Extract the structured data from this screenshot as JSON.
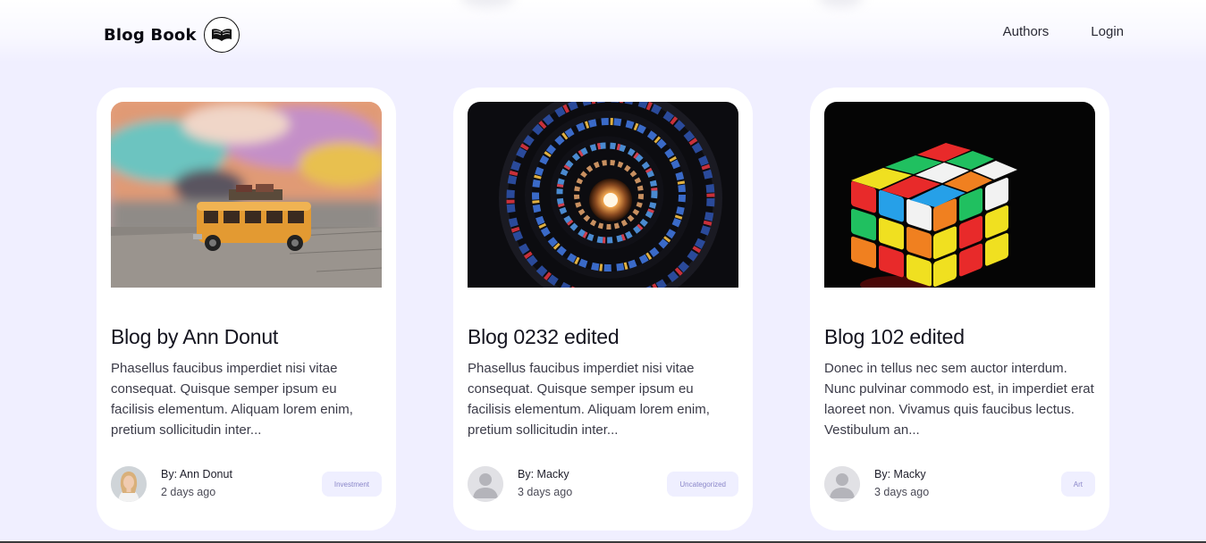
{
  "header": {
    "brand": "Blog Book",
    "logo_icon": "open-book-icon",
    "nav": [
      {
        "label": "Authors"
      },
      {
        "label": "Login"
      }
    ]
  },
  "posts": [
    {
      "title": "Blog by Ann Donut",
      "excerpt": "Phasellus faucibus imperdiet nisi vitae consequat. Quisque semper ipsum eu facilisis elementum. Aliquam lorem enim, pretium sollicitudin inter...",
      "author": "By: Ann Donut",
      "time": "2 days ago",
      "tag": "Investment",
      "image": "toy-bus-photo",
      "avatar": "author-photo"
    },
    {
      "title": "Blog 0232 edited",
      "excerpt": "Phasellus faucibus imperdiet nisi vitae consequat. Quisque semper ipsum eu facilisis elementum. Aliquam lorem enim, pretium sollicitudin inter...",
      "author": "By: Macky",
      "time": "3 days ago",
      "tag": "Uncategorized",
      "image": "stained-glass-spiral-photo",
      "avatar": "default-user-icon"
    },
    {
      "title": "Blog 102 edited",
      "excerpt": "Donec in tellus nec sem auctor interdum. Nunc pulvinar commodo est, in imperdiet erat laoreet non. Vivamus quis faucibus lectus. Vestibulum an...",
      "author": "By: Macky",
      "time": "3 days ago",
      "tag": "Art",
      "image": "rubiks-cube-photo",
      "avatar": "default-user-icon"
    }
  ],
  "colors": {
    "page_bg": "#f0efff",
    "card_bg": "#ffffff",
    "tag_bg": "#efefff",
    "tag_text": "#8a86c8"
  }
}
